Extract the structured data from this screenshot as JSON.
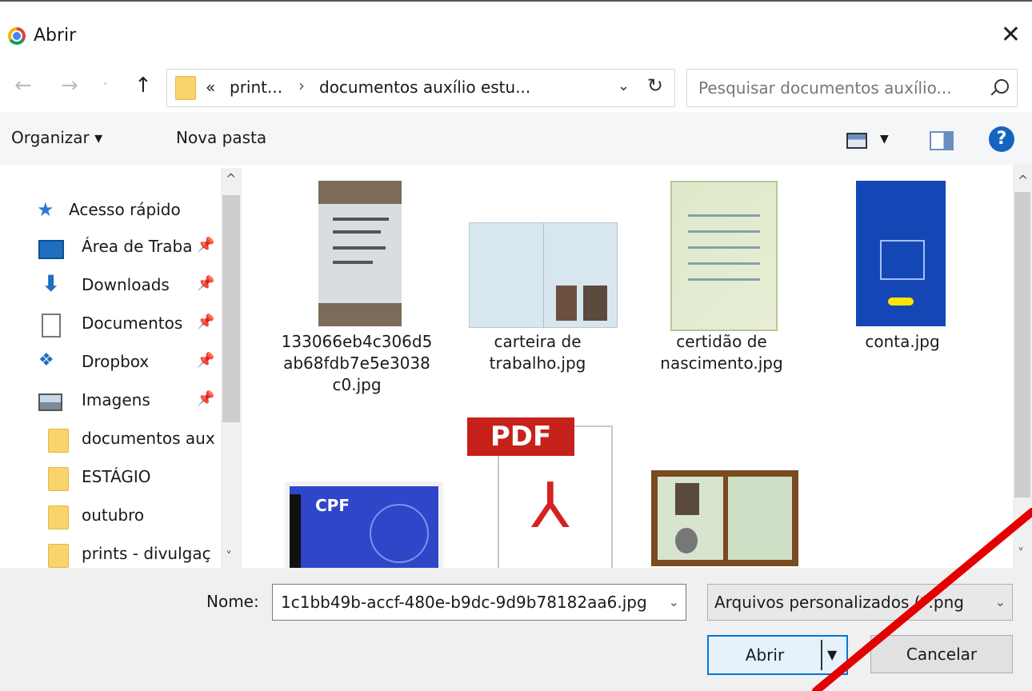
{
  "window": {
    "title": "Abrir"
  },
  "nav": {
    "breadcrumb": [
      "«",
      "print...",
      "›",
      "documentos auxílio estu..."
    ],
    "search_placeholder": "Pesquisar documentos auxílio..."
  },
  "toolbar": {
    "organize": "Organizar ▾",
    "new_folder": "Nova pasta"
  },
  "sidebar": {
    "items": [
      {
        "label": "Acesso rápido",
        "icon": "star-icon",
        "pinned": false
      },
      {
        "label": "Área de Traba",
        "icon": "desktop-icon",
        "pinned": true
      },
      {
        "label": "Downloads",
        "icon": "download-icon",
        "pinned": true
      },
      {
        "label": "Documentos",
        "icon": "document-icon",
        "pinned": true
      },
      {
        "label": "Dropbox",
        "icon": "dropbox-icon",
        "pinned": true
      },
      {
        "label": "Imagens",
        "icon": "images-icon",
        "pinned": true
      },
      {
        "label": "documentos aux",
        "icon": "folder-icon",
        "pinned": false
      },
      {
        "label": "ESTÁGIO",
        "icon": "folder-icon",
        "pinned": false
      },
      {
        "label": "outubro",
        "icon": "folder-icon",
        "pinned": false
      },
      {
        "label": "prints - divulgaç",
        "icon": "folder-icon",
        "pinned": false
      }
    ]
  },
  "files": [
    {
      "name": [
        "133066eb4c306d5",
        "ab68fdb7e5e3038",
        "c0.jpg"
      ],
      "thumb": "receipt-photo"
    },
    {
      "name": [
        "carteira de",
        "trabalho.jpg"
      ],
      "thumb": "work-card"
    },
    {
      "name": [
        "certidão de",
        "nascimento.jpg"
      ],
      "thumb": "birth-certificate"
    },
    {
      "name": [
        "conta.jpg"
      ],
      "thumb": "phone-screenshot"
    },
    {
      "name": [],
      "thumb": "cpf-card",
      "badge": "CPF"
    },
    {
      "name": [],
      "thumb": "pdf-file",
      "badge": "PDF"
    },
    {
      "name": [],
      "thumb": "id-card"
    }
  ],
  "footer": {
    "name_label": "Nome:",
    "name_value": "1c1bb49b-accf-480e-b9dc-9d9b78182aa6.jpg",
    "type_value": "Arquivos personalizados (*.png",
    "open_label": "Abrir",
    "cancel_label": "Cancelar"
  }
}
